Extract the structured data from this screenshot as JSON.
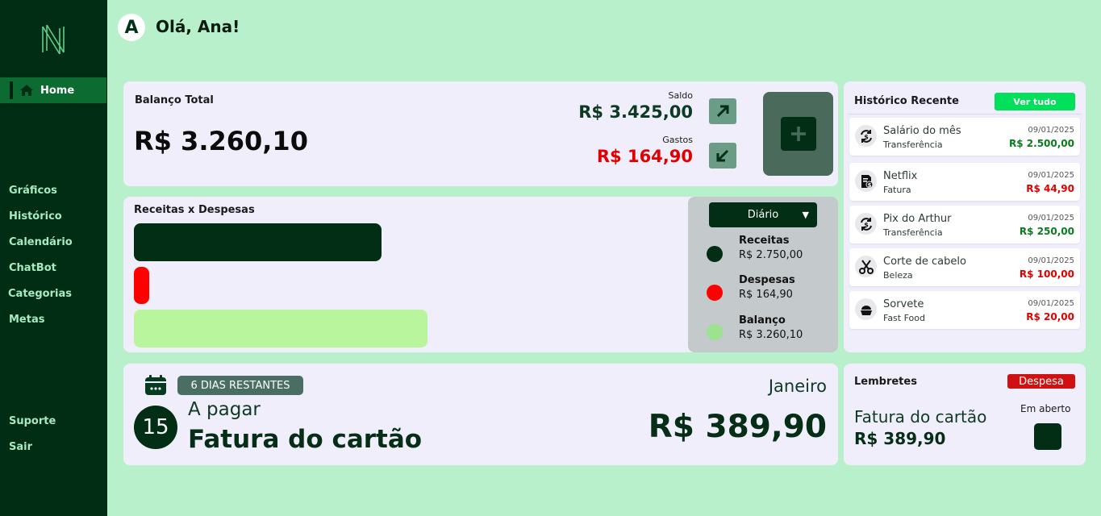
{
  "sidebar": {
    "logo": "N",
    "home_label": "Home",
    "items": [
      {
        "label": "Gráficos"
      },
      {
        "label": "Histórico"
      },
      {
        "label": "Calendário"
      },
      {
        "label": "ChatBot"
      },
      {
        "label": "Categorias"
      },
      {
        "label": "Metas"
      }
    ],
    "bottom_items": [
      {
        "label": "Suporte"
      },
      {
        "label": "Sair"
      }
    ]
  },
  "header": {
    "avatar_letter": "A",
    "greeting": "Olá, Ana!"
  },
  "balance": {
    "title": "Balanço Total",
    "total": "R$ 3.260,10",
    "saldo_label": "Saldo",
    "saldo_value": "R$ 3.425,00",
    "gastos_label": "Gastos",
    "gastos_value": "R$ 164,90",
    "icons": [
      "arrow-up-right-icon",
      "arrow-down-left-icon",
      "plus-icon"
    ]
  },
  "comparison": {
    "title": "Receitas x Despesas",
    "period": "Diário",
    "legend": [
      {
        "name": "Receitas",
        "value": "R$ 2.750,00",
        "color": "#012e15"
      },
      {
        "name": "Despesas",
        "value": "R$ 164,90",
        "color": "#ff0000"
      },
      {
        "name": "Balanço",
        "value": "R$ 3.260,10",
        "color": "#9be38f"
      }
    ]
  },
  "chart_data": {
    "type": "bar",
    "orientation": "horizontal",
    "categories": [
      "Receitas",
      "Despesas",
      "Balanço"
    ],
    "values": [
      2750.0,
      164.9,
      3260.1
    ],
    "colors": [
      "#012e15",
      "#ff0000",
      "#b9f59c"
    ],
    "title": "Receitas x Despesas"
  },
  "history": {
    "title": "Histórico Recente",
    "see_all": "Ver tudo",
    "transactions": [
      {
        "name": "Salário do mês",
        "category": "Transferência",
        "date": "09/01/2025",
        "value": "R$ 2.500,00",
        "type": "income",
        "icon": "transfer-icon"
      },
      {
        "name": "Netflix",
        "category": "Fatura",
        "date": "09/01/2025",
        "value": "R$ 44,90",
        "type": "expense",
        "icon": "bill-icon"
      },
      {
        "name": "Pix do Arthur",
        "category": "Transferência",
        "date": "09/01/2025",
        "value": "R$ 250,00",
        "type": "income",
        "icon": "transfer-icon"
      },
      {
        "name": "Corte de cabelo",
        "category": "Beleza",
        "date": "09/01/2025",
        "value": "R$ 100,00",
        "type": "expense",
        "icon": "scissors-icon"
      },
      {
        "name": "Sorvete",
        "category": "Fast Food",
        "date": "09/01/2025",
        "value": "R$ 20,00",
        "type": "expense",
        "icon": "food-icon"
      }
    ],
    "colors": {
      "income": "#0a7a1f",
      "expense": "#e00000"
    }
  },
  "upcoming": {
    "days_left": "6 DIAS RESTANTES",
    "day": "15",
    "label": "A pagar",
    "name": "Fatura do cartão",
    "month": "Janeiro",
    "amount": "R$ 389,90"
  },
  "reminders": {
    "title": "Lembretes",
    "badge": "Despesa",
    "name": "Fatura do cartão",
    "amount": "R$ 389,90",
    "status": "Em aberto"
  }
}
